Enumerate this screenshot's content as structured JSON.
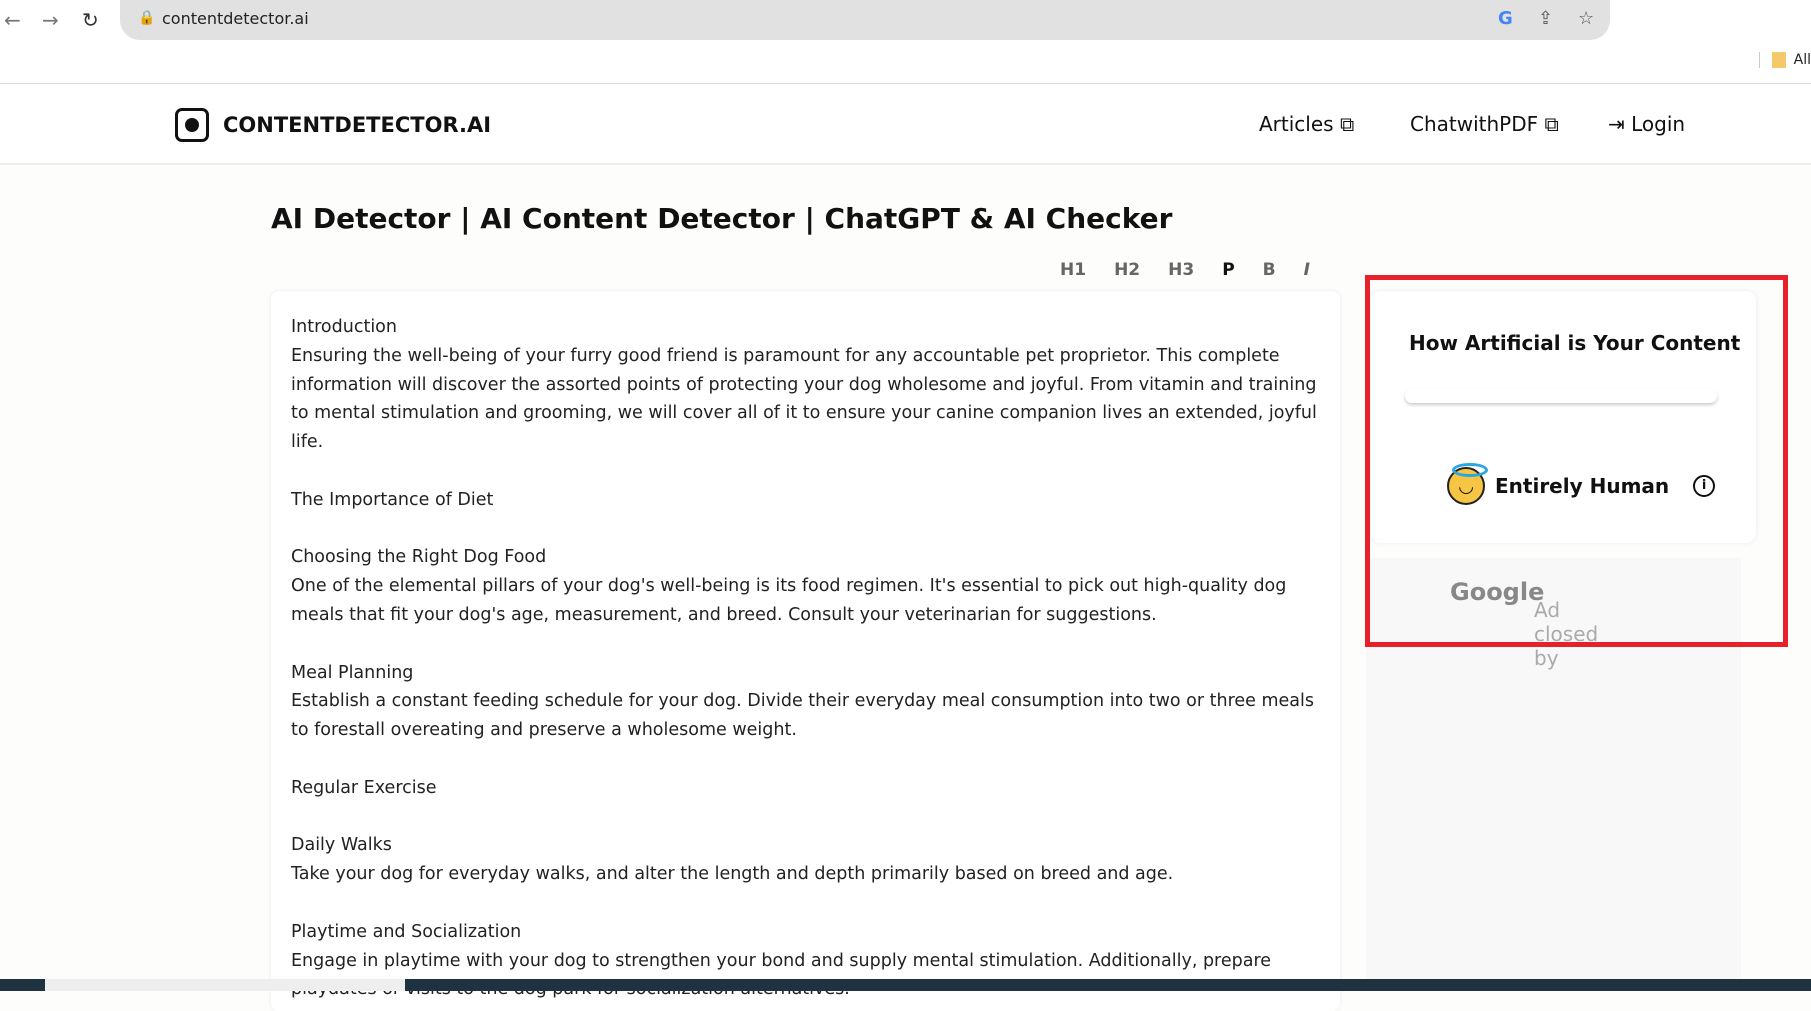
{
  "browser": {
    "url": "contentdetector.ai",
    "bookmark": "All"
  },
  "header": {
    "logo": "CONTENTDETECTOR.AI",
    "nav": [
      {
        "label": "Articles"
      },
      {
        "label": "ChatwithPDF"
      },
      {
        "label": "Login"
      }
    ]
  },
  "main": {
    "title": "AI Detector | AI Content Detector | ChatGPT & AI Checker",
    "toolbar": [
      "H1",
      "H2",
      "H3",
      "P",
      "B",
      "I"
    ],
    "paragraphs": [
      "Introduction",
      "Ensuring the well-being of your furry good friend is paramount for any accountable pet proprietor. This complete information will discover the assorted points of protecting your dog wholesome and joyful. From vitamin and training to mental stimulation and grooming, we will cover all of it to ensure your canine companion lives an extended, joyful life.",
      "",
      "The Importance of Diet",
      "",
      "Choosing the Right Dog Food",
      "One of the elemental pillars of your dog's well-being is its food regimen. It's essential to pick out high-quality dog meals that fit your dog's age, measurement, and breed. Consult your veterinarian for suggestions.",
      "",
      "Meal Planning",
      "Establish a constant feeding schedule for your dog. Divide their everyday meal consumption into two or three meals to forestall overeating and preserve a wholesome weight.",
      "",
      "Regular Exercise",
      "",
      "Daily Walks",
      "Take your dog for everyday walks, and alter the length and depth primarily based on breed and age.",
      "",
      "Playtime and Socialization",
      "Engage in playtime with your dog to strengthen your bond and supply mental stimulation. Additionally, prepare playdates or visits to the dog park for socialization alternatives."
    ]
  },
  "result": {
    "title": "How Artificial is Your Content",
    "verdict": "Entirely Human",
    "highlight_color": "#e8202a"
  },
  "ad": {
    "text": "Ad closed by",
    "brand": "Google"
  }
}
